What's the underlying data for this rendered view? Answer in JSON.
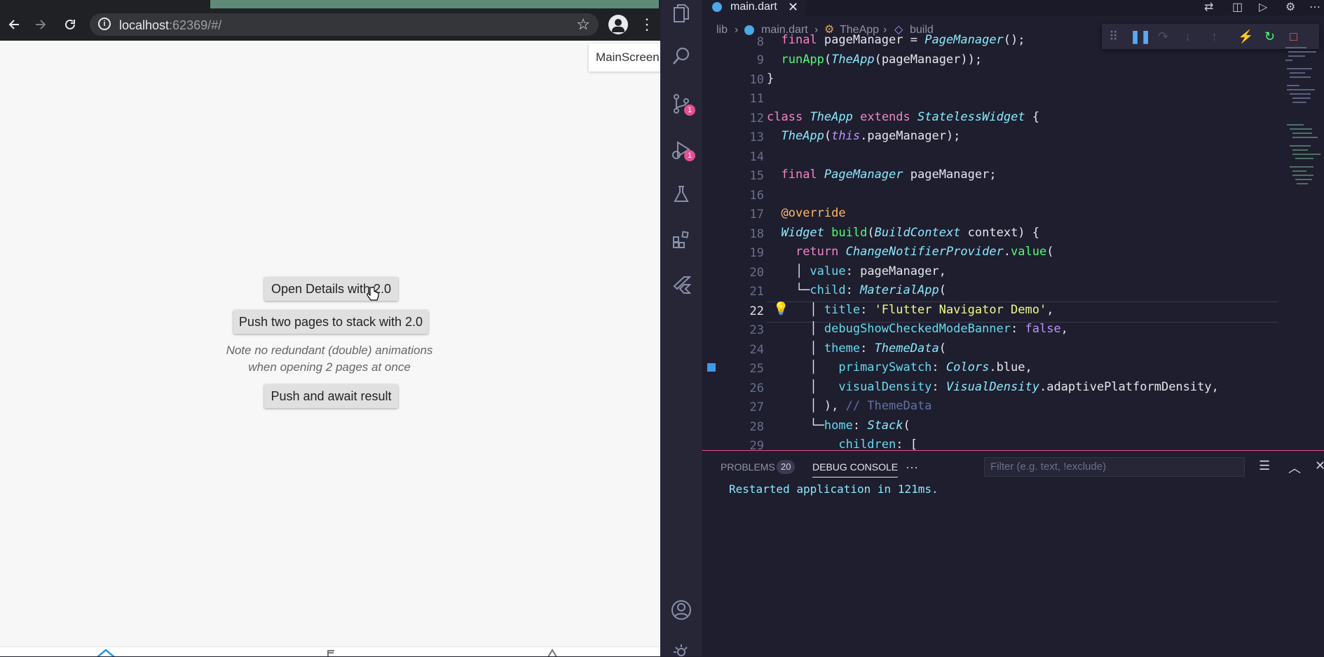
{
  "browser": {
    "url_host": "localhost",
    "url_port": ":62369/#/",
    "tooltip": "MainScreen",
    "buttons": {
      "open_details": "Open Details with 2.0",
      "push_two": "Push two pages to stack with 2.0",
      "push_await": "Push and await result"
    },
    "note_line1": "Note no redundant (double) animations",
    "note_line2": "when opening 2 pages at once"
  },
  "vscode": {
    "tab": "main.dart",
    "breadcrumb": {
      "folder": "lib",
      "file": "main.dart",
      "class": "TheApp",
      "method": "build"
    },
    "activity_badges": {
      "source_control": "1",
      "run_debug": "1"
    },
    "line_numbers": [
      "8",
      "9",
      "10",
      "11",
      "12",
      "13",
      "14",
      "15",
      "16",
      "17",
      "18",
      "19",
      "20",
      "21",
      "22",
      "23",
      "24",
      "25",
      "26",
      "27",
      "28",
      "29"
    ],
    "current_line": "22",
    "panel": {
      "problems_label": "PROBLEMS",
      "problems_count": "20",
      "debug_console_label": "DEBUG CONSOLE",
      "more": "···",
      "filter_placeholder": "Filter (e.g. text, !exclude)",
      "console_output": "Restarted application in 121ms."
    }
  },
  "icons": [
    "back-icon",
    "forward-icon",
    "reload-icon",
    "info-icon",
    "star-icon",
    "profile-icon",
    "kebab-icon",
    "explorer-icon",
    "search-icon",
    "source-control-icon",
    "run-debug-icon",
    "testing-icon",
    "extensions-icon",
    "flutter-icon",
    "account-icon",
    "settings-icon"
  ]
}
